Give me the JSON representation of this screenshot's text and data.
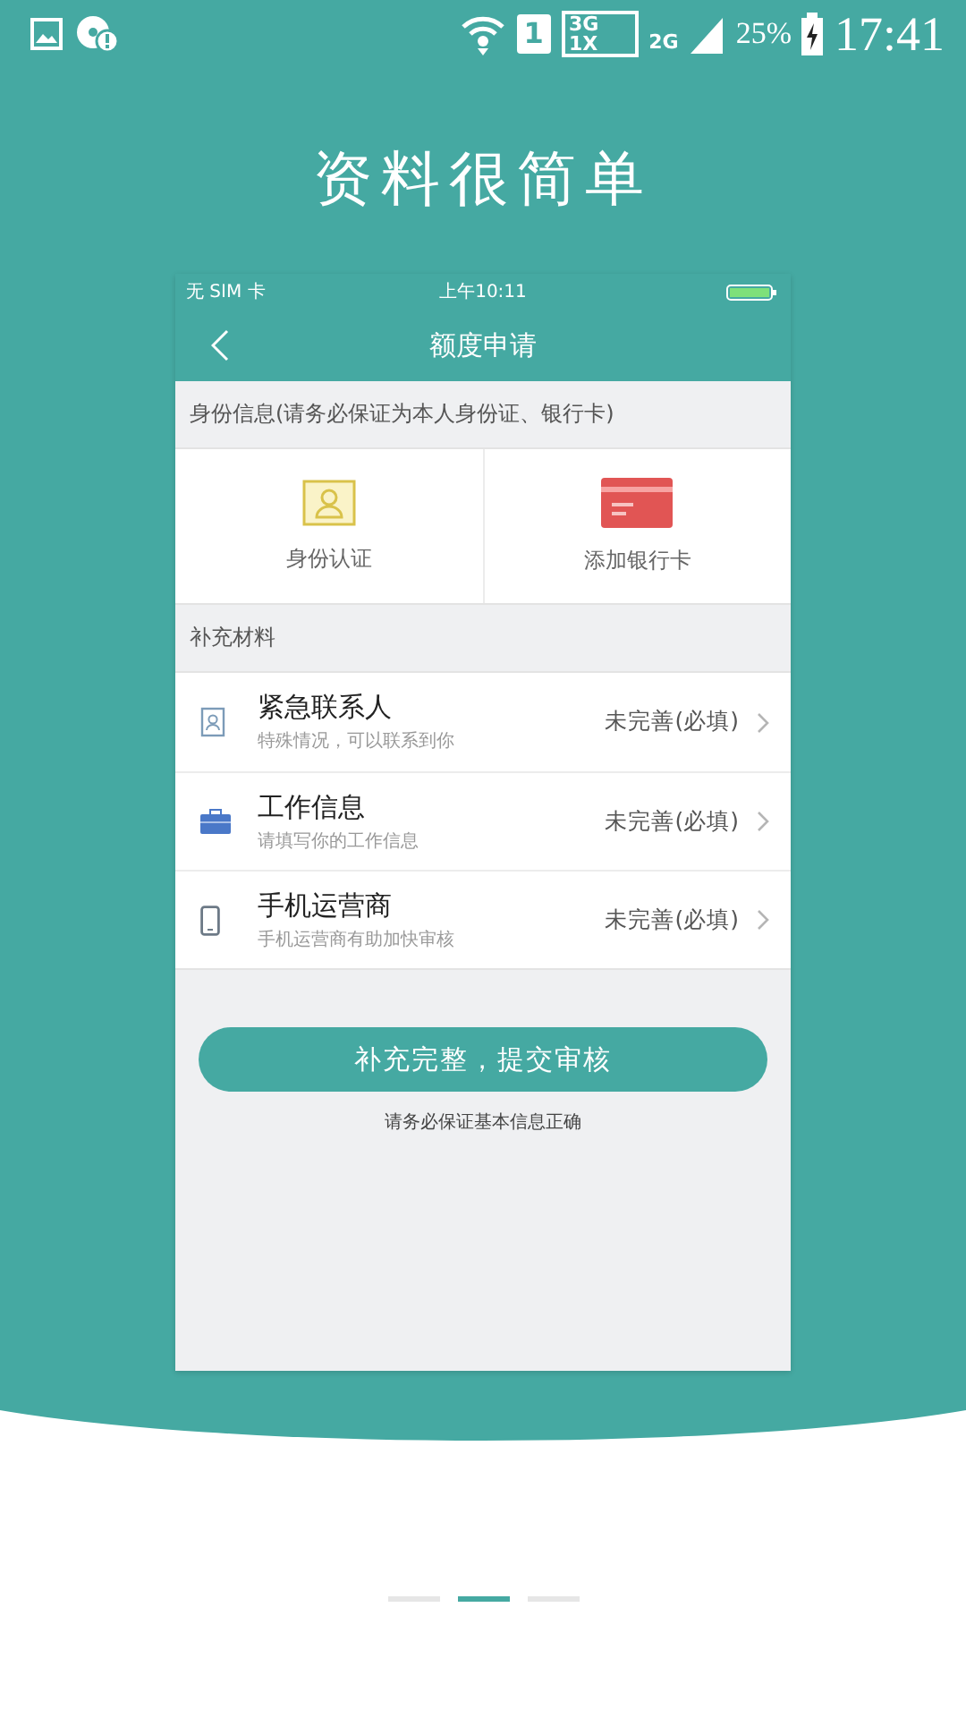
{
  "status_bar": {
    "sim_slot": "1",
    "network_top": "3G",
    "network_bottom": "1X",
    "network_second": "2G",
    "battery": "25%",
    "time": "17:41"
  },
  "headline": "资料很简单",
  "phone": {
    "status_bar": {
      "carrier": "无 SIM 卡",
      "time": "上午10:11"
    },
    "nav_title": "额度申请",
    "identity_section": {
      "header": "身份信息(请务必保证为本人身份证、银行卡)",
      "tiles": [
        {
          "kind": "id",
          "label": "身份认证"
        },
        {
          "kind": "card",
          "label": "添加银行卡"
        }
      ]
    },
    "materials_section": {
      "header": "补充材料",
      "rows": [
        {
          "kind": "contact",
          "title": "紧急联系人",
          "subtitle": "特殊情况，可以联系到你",
          "status": "未完善(必填)"
        },
        {
          "kind": "work",
          "title": "工作信息",
          "subtitle": "请填写你的工作信息",
          "status": "未完善(必填)"
        },
        {
          "kind": "mobile",
          "title": "手机运营商",
          "subtitle": "手机运营商有助加快审核",
          "status": "未完善(必填)"
        }
      ]
    },
    "submit_button": "补充完整，提交审核",
    "note": "请务必保证基本信息正确"
  },
  "pager": [
    {
      "selected": false
    },
    {
      "selected": true
    },
    {
      "selected": false
    }
  ]
}
